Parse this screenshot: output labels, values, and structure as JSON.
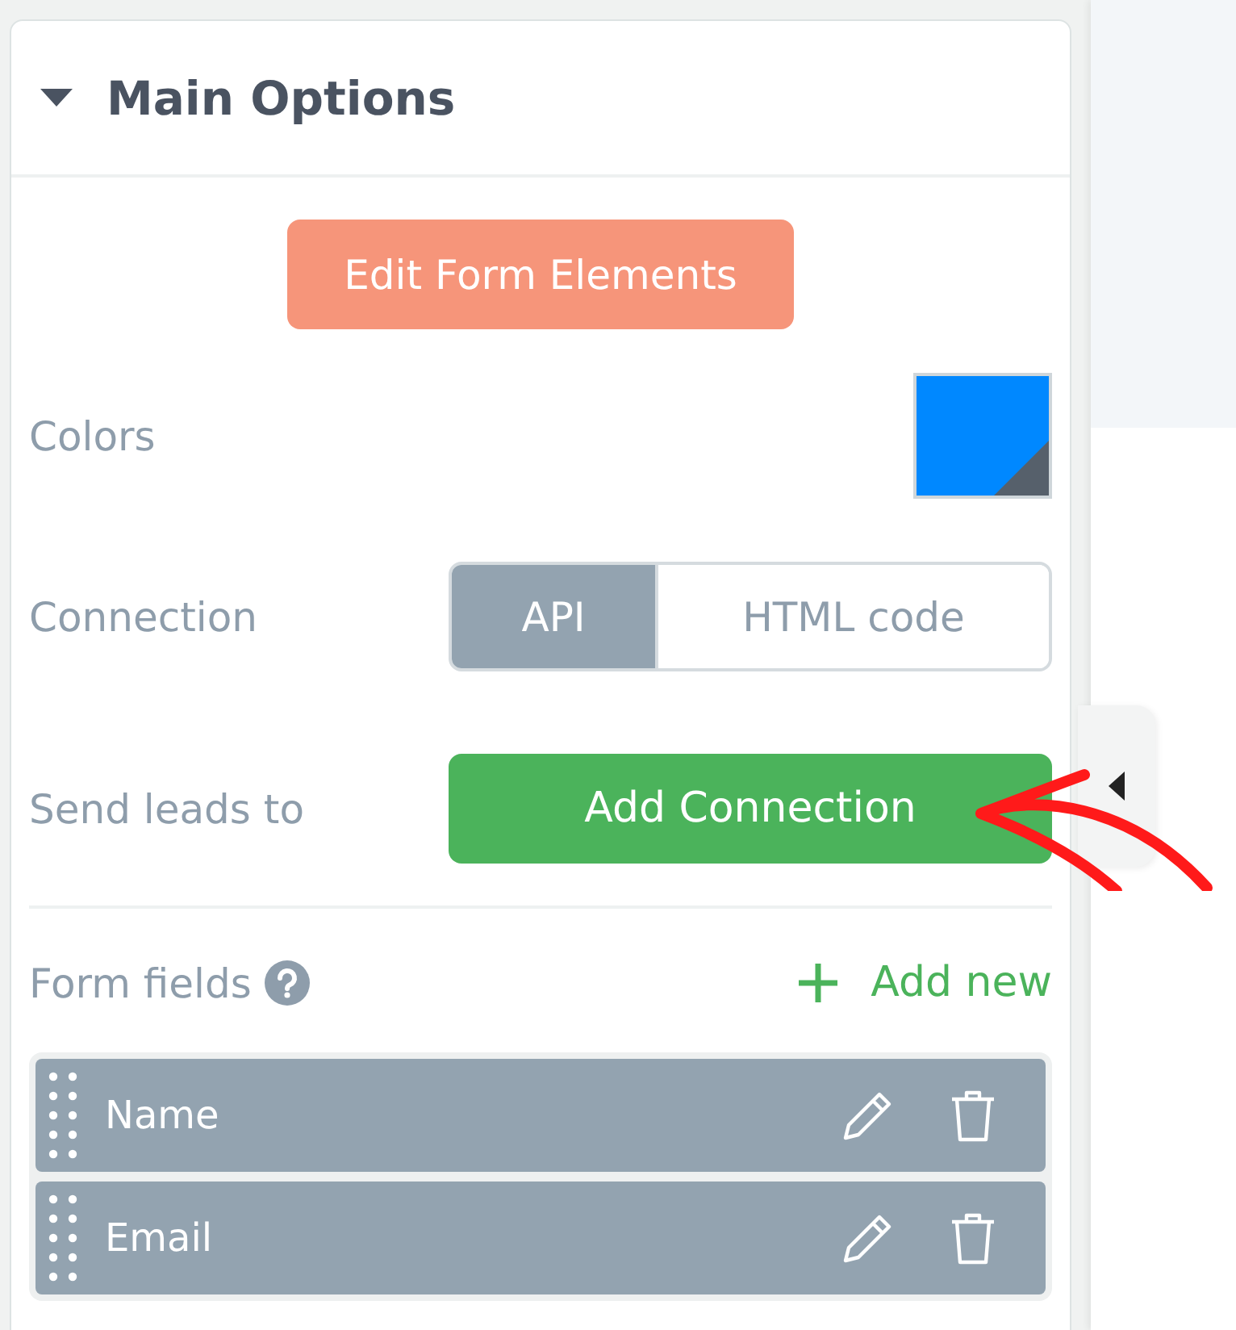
{
  "panel": {
    "title": "Main Options",
    "expanded": true
  },
  "edit_button": {
    "label": "Edit Form Elements"
  },
  "colors": {
    "label": "Colors"
  },
  "connection": {
    "label": "Connection",
    "options": [
      {
        "label": "API",
        "selected": true
      },
      {
        "label": "HTML code",
        "selected": false
      }
    ]
  },
  "send_leads": {
    "label": "Send leads to",
    "button": "Add Connection"
  },
  "form_fields": {
    "label": "Form fields",
    "add_label": "Add new",
    "fields": [
      {
        "label": "Name"
      },
      {
        "label": "Email"
      }
    ]
  }
}
